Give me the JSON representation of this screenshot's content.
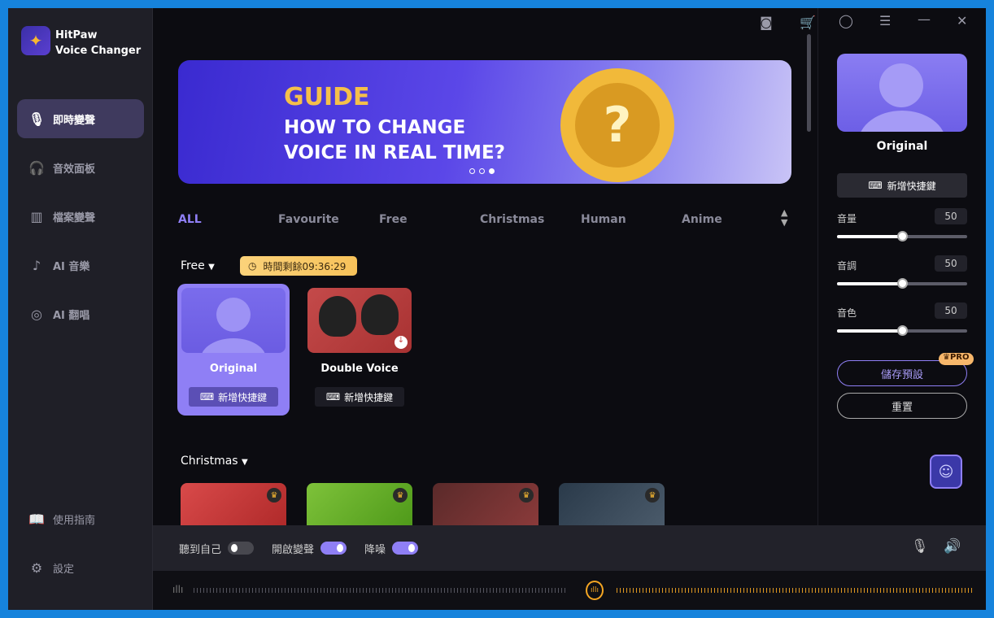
{
  "app": {
    "name_line1": "HitPaw",
    "name_line2": "Voice Changer"
  },
  "sidebar": {
    "items": [
      {
        "label": "即時變聲",
        "icon": "microphone-icon"
      },
      {
        "label": "音效面板",
        "icon": "headphones-icon"
      },
      {
        "label": "檔案變聲",
        "icon": "audio-file-icon"
      },
      {
        "label": "AI 音樂",
        "icon": "music-note-icon"
      },
      {
        "label": "AI 翻唱",
        "icon": "vinyl-icon"
      }
    ],
    "bottom": [
      {
        "label": "使用指南",
        "icon": "book-icon"
      },
      {
        "label": "設定",
        "icon": "gear-icon"
      }
    ]
  },
  "banner": {
    "line1": "GUIDE",
    "line2": "HOW TO CHANGE",
    "line3": "VOICE IN REAL TIME?",
    "slide": 3,
    "slides": 3
  },
  "tabs": [
    "ALL",
    "Favourite",
    "Free",
    "Christmas",
    "Human",
    "Anime"
  ],
  "free_section": {
    "title": "Free",
    "timer": "時間剩餘09:36:29"
  },
  "cards": [
    {
      "name": "Original",
      "shortcut": "新增快捷鍵"
    },
    {
      "name": "Double Voice",
      "shortcut": "新增快捷鍵"
    }
  ],
  "christmas_section": {
    "title": "Christmas"
  },
  "right": {
    "voice": "Original",
    "shortcut": "新增快捷鍵",
    "sliders": [
      {
        "label": "音量",
        "value": "50"
      },
      {
        "label": "音調",
        "value": "50"
      },
      {
        "label": "音色",
        "value": "50"
      }
    ],
    "save": "儲存預設",
    "pro": "PRO",
    "reset": "重置"
  },
  "bottom": {
    "toggles": [
      {
        "label": "聽到自己",
        "on": false
      },
      {
        "label": "開啟變聲",
        "on": true
      },
      {
        "label": "降噪",
        "on": true
      }
    ]
  },
  "colors": {
    "accent": "#8f7ff5",
    "timer": "#f7c25a",
    "waveform_active": "#f5a623"
  }
}
